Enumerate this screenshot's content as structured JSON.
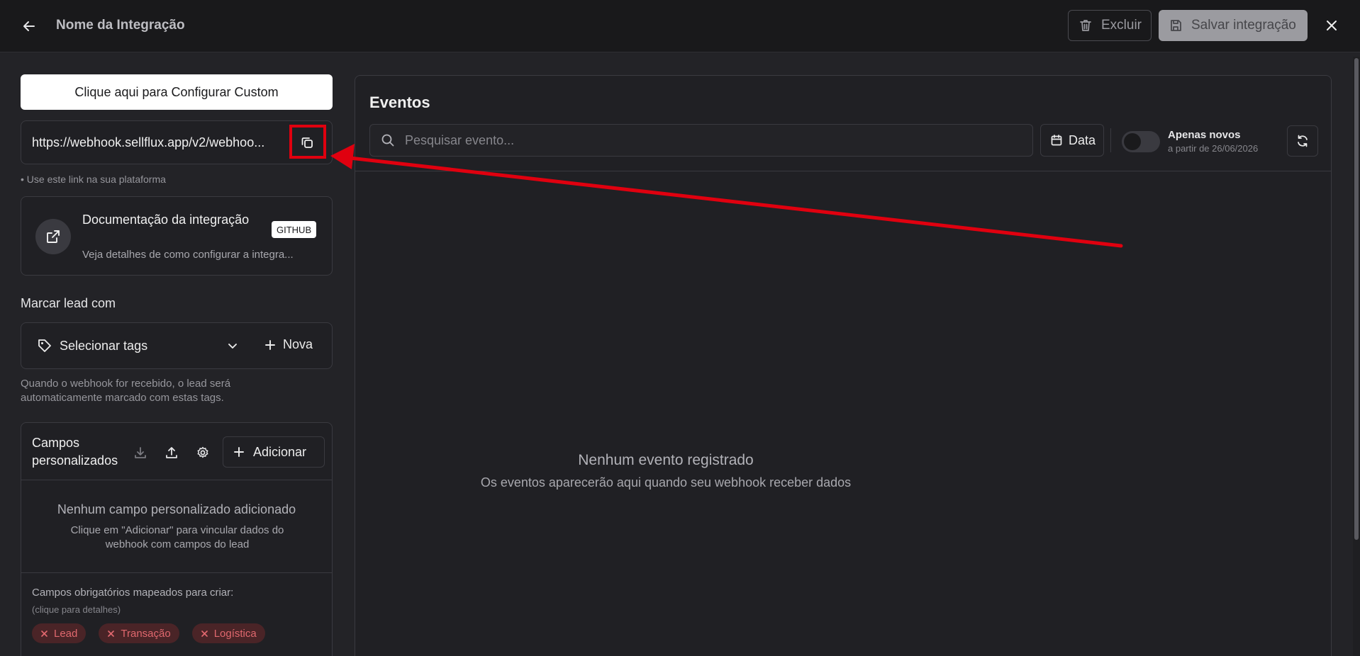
{
  "header": {
    "title": "Nome da Integração",
    "delete_label": "Excluir",
    "save_label": "Salvar integração"
  },
  "left": {
    "configure_label": "Clique aqui para Configurar Custom",
    "webhook_url": "https://webhook.sellflux.app/v2/webhoo...",
    "url_hint": "• Use este link na sua plataforma",
    "doc": {
      "title": "Documentação da integração",
      "description": "Veja detalhes de como configurar a integra...",
      "badge": "GITHUB"
    },
    "tags": {
      "heading": "Marcar lead com",
      "select_label": "Selecionar tags",
      "new_label": "Nova",
      "hint": "Quando o webhook for recebido, o lead será automaticamente marcado com estas tags."
    },
    "fields": {
      "title": "Campos personalizados",
      "add_label": "Adicionar",
      "empty_title": "Nenhum campo personalizado adicionado",
      "empty_desc": "Clique em \"Adicionar\" para vincular dados do webhook com campos do lead",
      "required_title": "Campos obrigatórios mapeados para criar:",
      "required_hint": "(clique para detalhes)",
      "chips": [
        "Lead",
        "Transação",
        "Logística"
      ]
    }
  },
  "events": {
    "title": "Eventos",
    "search_placeholder": "Pesquisar evento...",
    "date_label": "Data",
    "toggle_label": "Apenas novos",
    "toggle_sub": "a partir de 26/06/2026",
    "empty_title": "Nenhum evento registrado",
    "empty_desc": "Os eventos aparecerão aqui quando seu webhook receber dados"
  },
  "colors": {
    "background": "#232327",
    "header": "#19191b",
    "annotation": "#e0000f",
    "chip_text": "#e0686e"
  },
  "icons": {
    "back": "arrow-left-icon",
    "trash": "trash-icon",
    "save": "floppy-disk-icon",
    "close": "close-icon",
    "copy": "copy-icon",
    "external": "external-link-icon",
    "tag": "tag-icon",
    "chevron": "chevron-down-icon",
    "plus": "plus-icon",
    "download": "download-icon",
    "upload": "upload-icon",
    "gear": "gear-icon",
    "search": "search-icon",
    "calendar": "calendar-icon",
    "refresh": "refresh-icon"
  }
}
